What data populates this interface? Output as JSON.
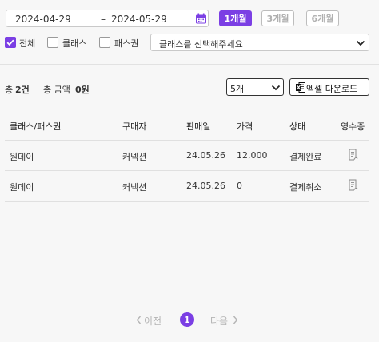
{
  "date_range": {
    "start": "2024-04-29",
    "separator": "–",
    "end": "2024-05-29"
  },
  "period_buttons": [
    {
      "label": "1개월",
      "active": true
    },
    {
      "label": "3개월",
      "active": false
    },
    {
      "label": "6개월",
      "active": false
    }
  ],
  "filters": {
    "all": {
      "label": "전체",
      "checked": true
    },
    "class": {
      "label": "클래스",
      "checked": false
    },
    "pass": {
      "label": "패스권",
      "checked": false
    },
    "class_select": {
      "value": "클래스를 선택해주세요"
    }
  },
  "summary": {
    "total_label": "총",
    "total_count": "2건",
    "amount_label": "총 금액",
    "amount_value": "0원"
  },
  "page_size": "5개",
  "excel_button": "엑셀 다운로드",
  "table": {
    "headers": [
      "클래스/패스권",
      "구매자",
      "판매일",
      "가격",
      "상태",
      "영수증"
    ],
    "rows": [
      {
        "item": "원데이",
        "buyer": "커넥션",
        "date": "24.05.26",
        "price": "12,000",
        "status": "결제완료"
      },
      {
        "item": "원데이",
        "buyer": "커넥션",
        "date": "24.05.26",
        "price": "0",
        "status": "결제취소"
      }
    ]
  },
  "pagination": {
    "prev": "이전",
    "current": "1",
    "next": "다음"
  },
  "colors": {
    "accent": "#7b3fe4"
  }
}
